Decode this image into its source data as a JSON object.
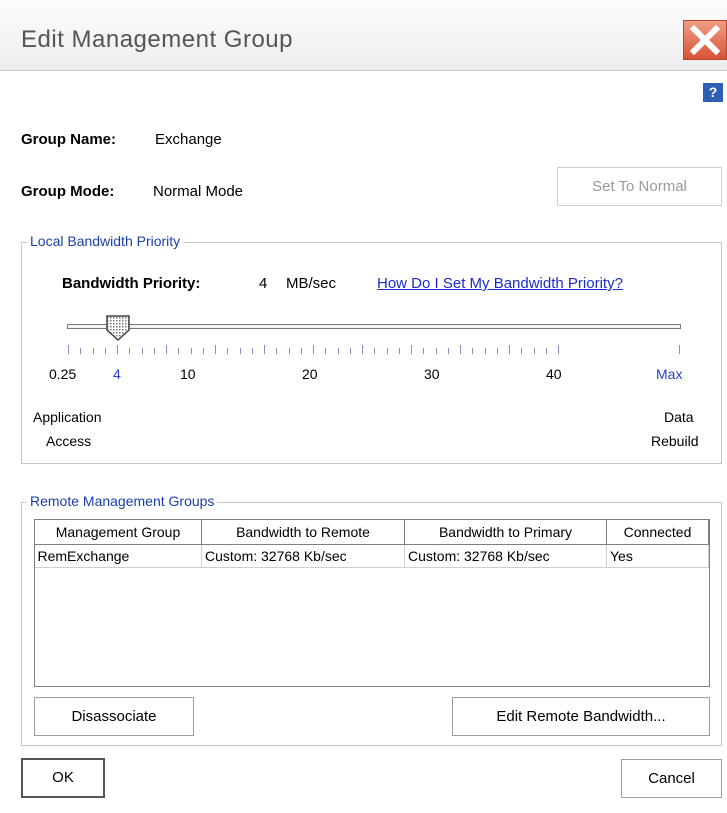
{
  "window": {
    "title": "Edit Management Group",
    "help_glyph": "?"
  },
  "group": {
    "name_label": "Group Name:",
    "name_value": "Exchange",
    "mode_label": "Group Mode:",
    "mode_value": "Normal Mode",
    "set_normal_button": "Set To Normal"
  },
  "local_bandwidth": {
    "legend": "Local Bandwidth Priority",
    "priority_label": "Bandwidth Priority:",
    "priority_value": "4",
    "priority_unit": "MB/sec",
    "help_link": "How Do I Set My Bandwidth Priority?",
    "slider_value": 4,
    "tick_labels": [
      "0.25",
      "4",
      "10",
      "20",
      "30",
      "40",
      "Max"
    ],
    "left_end_label_1": "Application",
    "left_end_label_2": "Access",
    "right_end_label_1": "Data",
    "right_end_label_2": "Rebuild"
  },
  "remote_groups": {
    "legend": "Remote Management Groups",
    "columns": [
      "Management Group",
      "Bandwidth to Remote",
      "Bandwidth to Primary",
      "Connected"
    ],
    "rows": [
      [
        "RemExchange",
        "Custom: 32768 Kb/sec",
        "Custom: 32768 Kb/sec",
        "Yes"
      ]
    ],
    "disassociate_button": "Disassociate",
    "edit_remote_button": "Edit Remote Bandwidth..."
  },
  "footer": {
    "ok_button": "OK",
    "cancel_button": "Cancel"
  },
  "colors": {
    "legend": "#1a3fa8",
    "link": "#1a2dc8",
    "close": "#d85437",
    "help": "#2f5fb5"
  }
}
